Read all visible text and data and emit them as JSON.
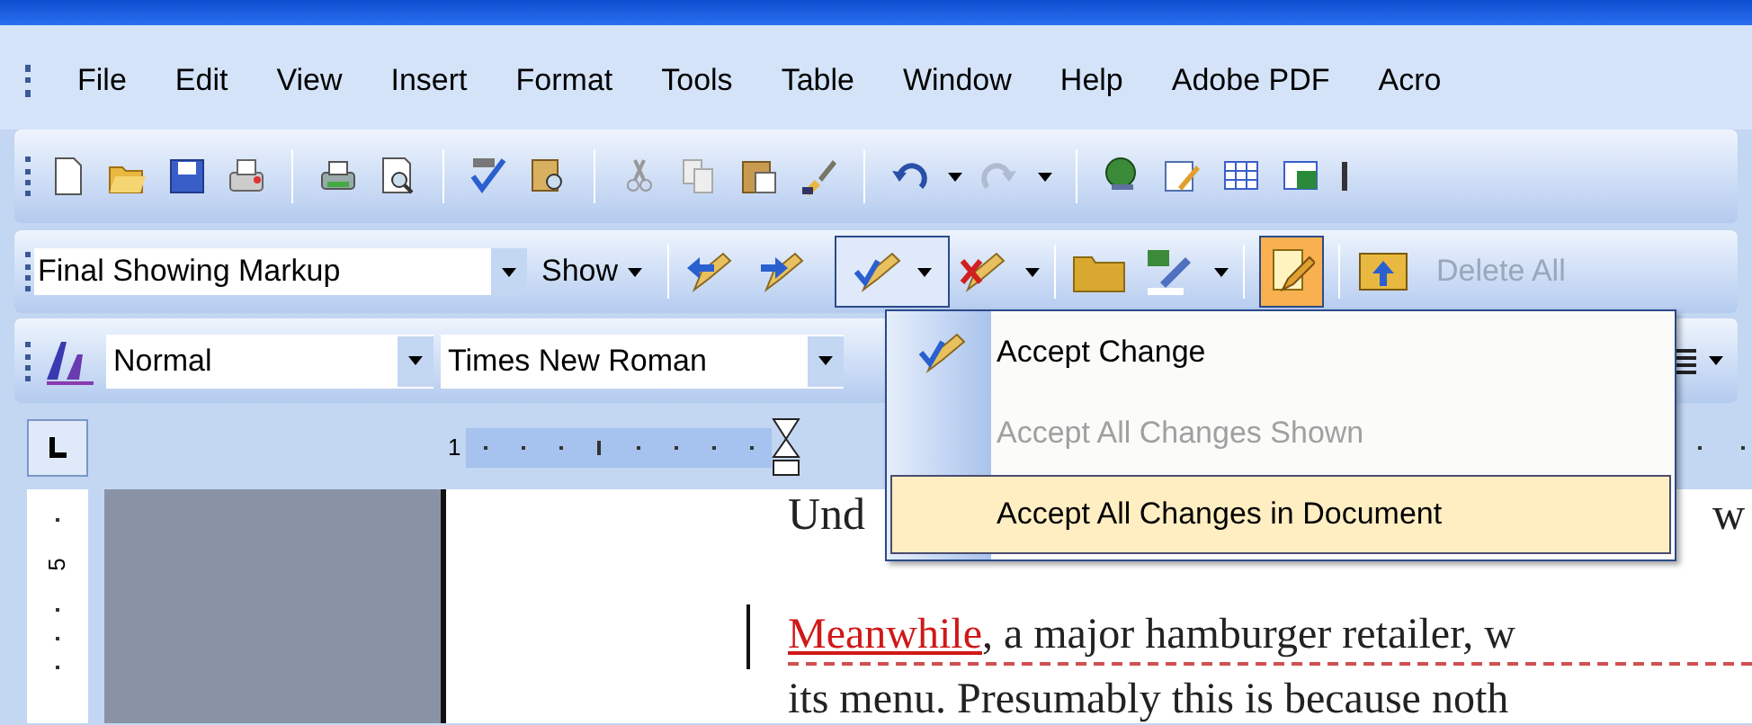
{
  "menu_bar": {
    "items": [
      "File",
      "Edit",
      "View",
      "Insert",
      "Format",
      "Tools",
      "Table",
      "Window",
      "Help",
      "Adobe PDF",
      "Acro"
    ]
  },
  "reviewing_toolbar": {
    "display_mode": "Final Showing Markup",
    "show_button": "Show",
    "delete_button": {
      "label": "Delete All",
      "disabled": true
    }
  },
  "formatting_toolbar": {
    "style": "Normal",
    "font": "Times New Roman"
  },
  "accept_menu": {
    "items": [
      {
        "label": "Accept Change",
        "disabled": false,
        "selected": false,
        "kind": "icon"
      },
      {
        "label": "Accept All Changes Shown",
        "disabled": true,
        "selected": false,
        "kind": "plain"
      },
      {
        "label": "Accept All Changes in Document",
        "disabled": false,
        "selected": true,
        "kind": "plain"
      }
    ]
  },
  "ruler": {
    "horizontal_number": "1",
    "vertical_number": "5"
  },
  "document": {
    "heading_fragments": [
      "Und",
      "w"
    ],
    "lines": [
      {
        "runs": [
          {
            "text": "Meanwhile",
            "kind": "insertion"
          },
          {
            "text": ", a major hamburger retailer, w",
            "kind": "normal"
          }
        ],
        "changed": true
      },
      {
        "runs": [
          {
            "text": "its menu. Presumably this is because noth",
            "kind": "normal"
          }
        ],
        "changed": false
      }
    ]
  }
}
